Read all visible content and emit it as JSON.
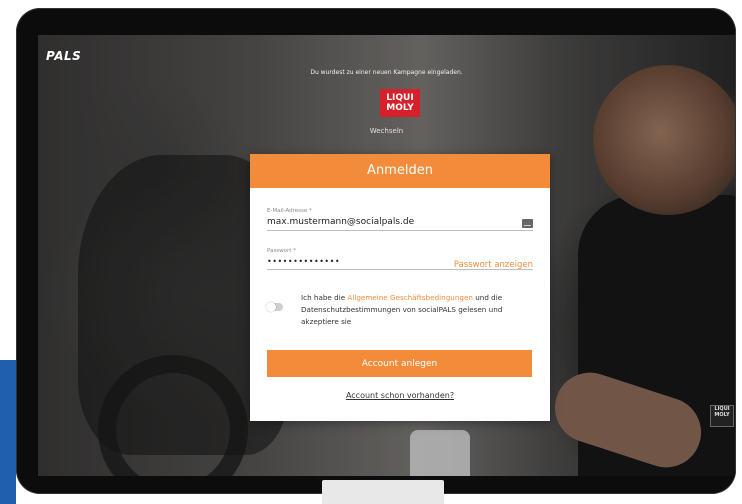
{
  "brand": "socialPALS",
  "brand_visible": "PALS",
  "invite_text": "Du wurdest zu einer neuen Kampagne eingeladen.",
  "partner_logo": {
    "line1": "LIQUI",
    "line2": "MOLY"
  },
  "switch_link": "Wechseln",
  "jacket_logo": {
    "line1": "LIQUI",
    "line2": "MOLY"
  },
  "modal": {
    "title": "Anmelden",
    "email": {
      "label": "E-Mail-Adresse *",
      "value": "max.mustermann@socialpals.de"
    },
    "password": {
      "label": "Passwort *",
      "value": "••••••••••••••",
      "show_label": "Passwort anzeigen"
    },
    "consent": {
      "before": "Ich habe die ",
      "link": "Allgemeine Geschäftsbedingungen",
      "after": " und die Datenschutzbestimmungen von socialPALS gelesen und akzeptiere sie",
      "checked": false
    },
    "submit_label": "Account anlegen",
    "existing_account_link": "Account schon vorhanden?"
  },
  "colors": {
    "accent": "#f28c3a",
    "side_accent": "#1f5fae",
    "logo_red": "#d6202a"
  }
}
